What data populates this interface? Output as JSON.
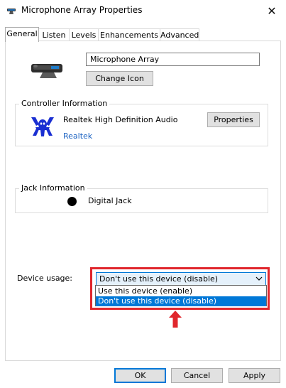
{
  "window": {
    "title": "Microphone Array Properties",
    "close_glyph": "✕"
  },
  "tabs": [
    {
      "label": "General",
      "active": true
    },
    {
      "label": "Listen",
      "active": false
    },
    {
      "label": "Levels",
      "active": false
    },
    {
      "label": "Enhancements",
      "active": false
    },
    {
      "label": "Advanced",
      "active": false
    }
  ],
  "device": {
    "name_value": "Microphone Array",
    "change_icon_label": "Change Icon"
  },
  "controller": {
    "group_label": "Controller Information",
    "name": "Realtek High Definition Audio",
    "vendor": "Realtek",
    "properties_label": "Properties"
  },
  "jack": {
    "group_label": "Jack Information",
    "name": "Digital Jack"
  },
  "device_usage": {
    "label": "Device usage:",
    "selected": "Don't use this device (disable)",
    "options": [
      "Use this device (enable)",
      "Don't use this device (disable)"
    ]
  },
  "footer": {
    "ok_label": "OK",
    "cancel_label": "Cancel",
    "apply_label": "Apply"
  },
  "colors": {
    "accent": "#0078d7",
    "highlight_red": "#e0262c",
    "link": "#1c63c2",
    "realtek_blue": "#1a2fd2"
  }
}
